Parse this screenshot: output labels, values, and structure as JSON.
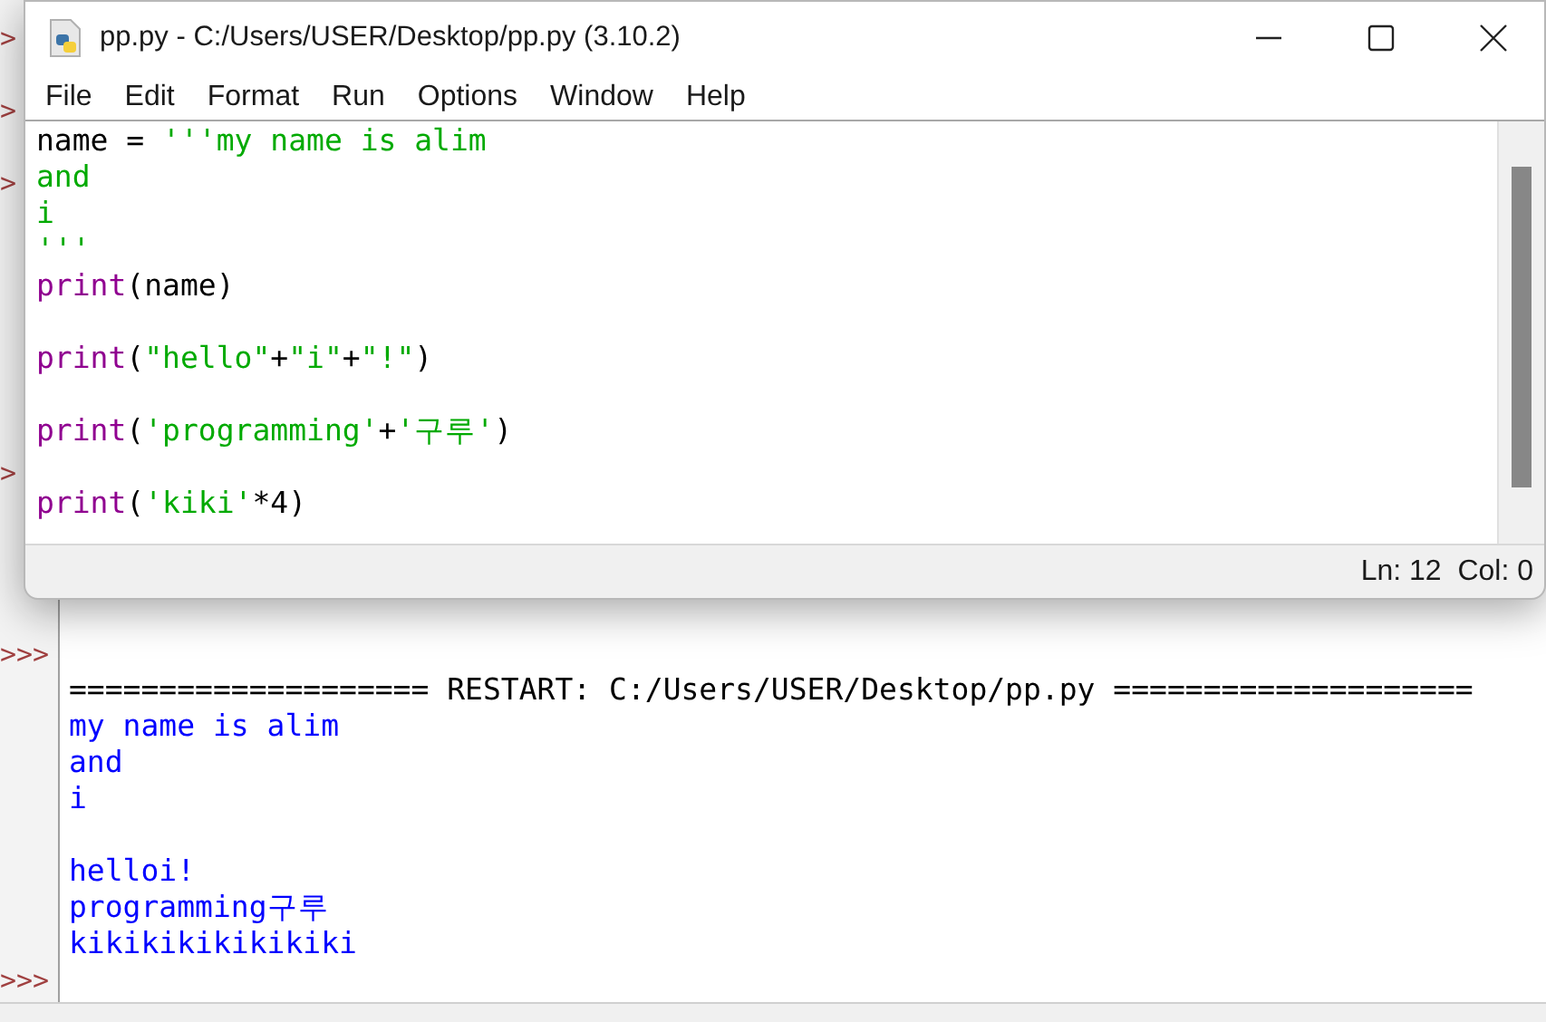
{
  "shell": {
    "rows": [
      {
        "prompt": ">"
      },
      {},
      {
        "prompt": ">"
      },
      {},
      {
        "prompt": ">"
      },
      {},
      {},
      {},
      {},
      {},
      {},
      {},
      {
        "prompt": ">"
      },
      {},
      {},
      {},
      {},
      {
        "prompt": ">>>"
      },
      {
        "kind": "restart",
        "text": "==================== RESTART: C:/Users/USER/Desktop/pp.py ===================="
      },
      {
        "kind": "output",
        "text": "my name is alim"
      },
      {
        "kind": "output",
        "text": "and"
      },
      {
        "kind": "output",
        "text": "i"
      },
      {},
      {
        "kind": "output",
        "text": "helloi!"
      },
      {
        "kind": "output",
        "text": "programming구루"
      },
      {
        "kind": "output",
        "text": "kikikikikikikiki"
      },
      {
        "prompt": ">>>"
      }
    ]
  },
  "editor": {
    "title": "pp.py - C:/Users/USER/Desktop/pp.py (3.10.2)",
    "menu": [
      "File",
      "Edit",
      "Format",
      "Run",
      "Options",
      "Window",
      "Help"
    ],
    "lines": [
      {
        "kind": "code",
        "segments": [
          {
            "kind": "plain",
            "text": "name = "
          },
          {
            "kind": "string",
            "text": "'''my name is alim"
          }
        ]
      },
      {
        "kind": "code",
        "segments": [
          {
            "kind": "string",
            "text": "and"
          }
        ]
      },
      {
        "kind": "code",
        "segments": [
          {
            "kind": "string",
            "text": "i"
          }
        ]
      },
      {
        "kind": "code",
        "segments": [
          {
            "kind": "string",
            "text": "'''"
          }
        ]
      },
      {
        "kind": "code",
        "segments": [
          {
            "kind": "builtin",
            "text": "print"
          },
          {
            "kind": "plain",
            "text": "(name)"
          }
        ]
      },
      {
        "kind": "blank"
      },
      {
        "kind": "code",
        "segments": [
          {
            "kind": "builtin",
            "text": "print"
          },
          {
            "kind": "plain",
            "text": "("
          },
          {
            "kind": "string",
            "text": "\"hello\""
          },
          {
            "kind": "plain",
            "text": "+"
          },
          {
            "kind": "string",
            "text": "\"i\""
          },
          {
            "kind": "plain",
            "text": "+"
          },
          {
            "kind": "string",
            "text": "\"!\""
          },
          {
            "kind": "plain",
            "text": ")"
          }
        ]
      },
      {
        "kind": "blank"
      },
      {
        "kind": "code",
        "segments": [
          {
            "kind": "builtin",
            "text": "print"
          },
          {
            "kind": "plain",
            "text": "("
          },
          {
            "kind": "string",
            "text": "'programming'"
          },
          {
            "kind": "plain",
            "text": "+"
          },
          {
            "kind": "string",
            "text": "'구루'"
          },
          {
            "kind": "plain",
            "text": ")"
          }
        ]
      },
      {
        "kind": "blank"
      },
      {
        "kind": "code",
        "segments": [
          {
            "kind": "builtin",
            "text": "print"
          },
          {
            "kind": "plain",
            "text": "("
          },
          {
            "kind": "string",
            "text": "'kiki'"
          },
          {
            "kind": "plain",
            "text": "*4)"
          }
        ]
      }
    ],
    "status": "Ln: 12  Col: 0"
  }
}
